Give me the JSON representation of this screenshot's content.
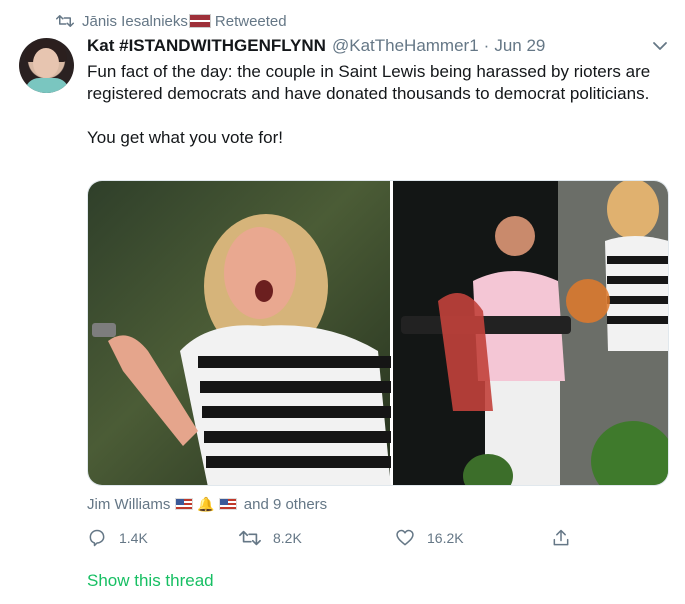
{
  "retweet": {
    "icon": "retweet-icon",
    "user": "Jānis Iesalnieks",
    "flag": "latvia-flag",
    "label": "Retweeted"
  },
  "tweet": {
    "name": "Kat #ISTANDWITHGENFLYNN",
    "handle": "@KatTheHammer1",
    "separator": "·",
    "date": "Jun 29",
    "text_p1": "Fun fact of the day: the couple in Saint Lewis being harassed by rioters are registered democrats and have donated thousands to democrat politicians.",
    "text_p2": "You get what you vote for!"
  },
  "likers": {
    "name": "Jim Williams",
    "others": "and 9 others"
  },
  "actions": {
    "reply_count": "1.4K",
    "retweet_count": "8.2K",
    "like_count": "16.2K"
  },
  "show_thread": "Show this thread",
  "colors": {
    "text": "#14171a",
    "muted": "#657786",
    "thread_link": "#17bf63"
  }
}
